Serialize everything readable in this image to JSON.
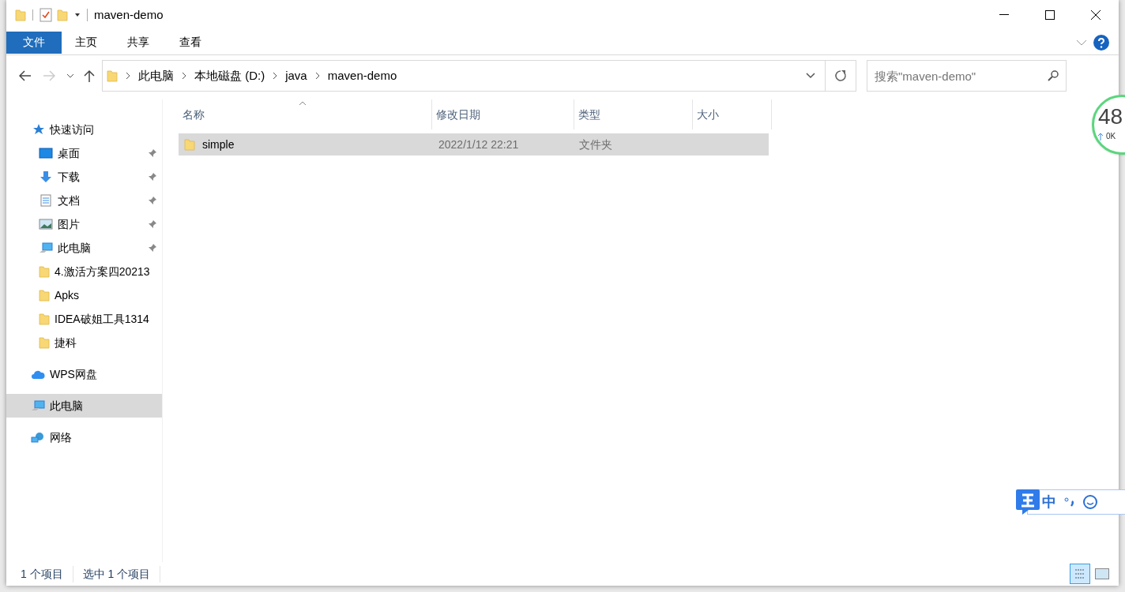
{
  "window": {
    "title": "maven-demo"
  },
  "ribbon_tabs": [
    {
      "label": "文件",
      "selected": true
    },
    {
      "label": "主页",
      "selected": false
    },
    {
      "label": "共享",
      "selected": false
    },
    {
      "label": "查看",
      "selected": false
    }
  ],
  "navigation": {
    "back_disabled": false,
    "forward_disabled": true
  },
  "address_bar": {
    "path": [
      "此电脑",
      "本地磁盘 (D:)",
      "java",
      "maven-demo"
    ]
  },
  "search": {
    "placeholder": "搜索\"maven-demo\""
  },
  "sidebar": {
    "items": [
      {
        "kind": "star",
        "label": "快速访问",
        "selected": false,
        "children": [
          {
            "kind": "desktop",
            "label": "桌面",
            "pinned": true,
            "selected": false
          },
          {
            "kind": "download",
            "label": "下载",
            "pinned": true,
            "selected": false
          },
          {
            "kind": "document",
            "label": "文档",
            "pinned": true,
            "selected": false
          },
          {
            "kind": "picture",
            "label": "图片",
            "pinned": true,
            "selected": false
          },
          {
            "kind": "computer",
            "label": "此电脑",
            "pinned": true,
            "selected": false
          },
          {
            "kind": "folder",
            "label": "4.激活方案四20213",
            "pinned": false,
            "selected": false
          },
          {
            "kind": "folder",
            "label": "Apks",
            "pinned": false,
            "selected": false
          },
          {
            "kind": "folder",
            "label": "IDEA破姐工具1314",
            "pinned": false,
            "selected": false
          },
          {
            "kind": "folder",
            "label": "捷科",
            "pinned": false,
            "selected": false
          }
        ]
      },
      {
        "kind": "cloud",
        "label": "WPS网盘",
        "selected": false
      },
      {
        "kind": "computer",
        "label": "此电脑",
        "selected": true
      },
      {
        "kind": "network",
        "label": "网络",
        "selected": false
      }
    ]
  },
  "table": {
    "columns": [
      "名称",
      "修改日期",
      "类型",
      "大小"
    ],
    "rows": [
      {
        "name": "simple",
        "modified": "2022/1/12 22:21",
        "type": "文件夹",
        "selected": true
      }
    ]
  },
  "status_bar": [
    "1 个项目",
    "选中 1 个项目"
  ],
  "speed_widget": {
    "value": "48",
    "upload": "0K"
  },
  "ime_toolbar": {
    "mode": "中"
  }
}
